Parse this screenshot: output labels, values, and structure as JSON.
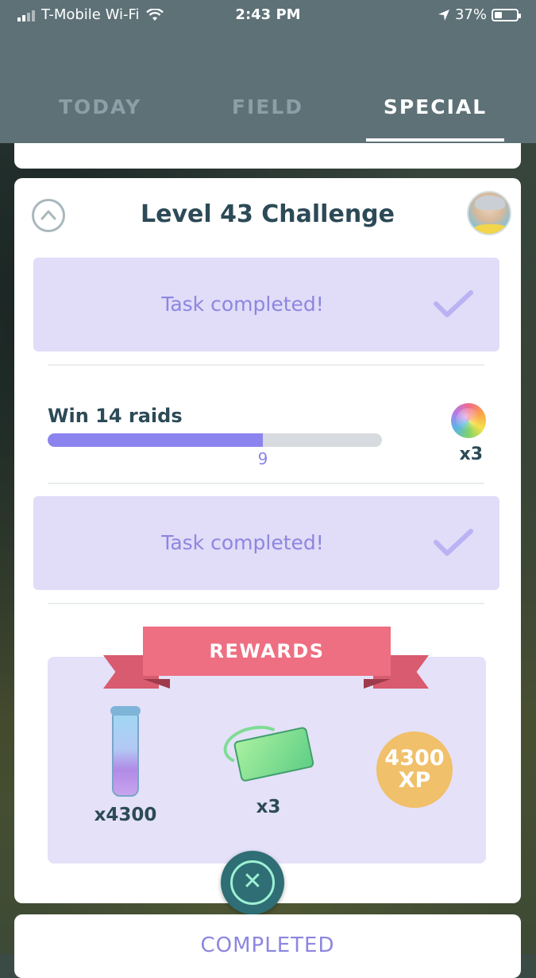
{
  "status_bar": {
    "carrier": "T-Mobile Wi-Fi",
    "time": "2:43 PM",
    "battery": "37%"
  },
  "tabs": [
    {
      "label": "TODAY",
      "active": false
    },
    {
      "label": "FIELD",
      "active": false
    },
    {
      "label": "SPECIAL",
      "active": true
    }
  ],
  "challenge": {
    "title": "Level 43 Challenge",
    "tasks": [
      {
        "status": "Task completed!"
      },
      {
        "label": "Win 14 raids",
        "progress": 9,
        "goal": 14,
        "reward_icon": "rainbow-berry-icon",
        "reward_count": "x3"
      },
      {
        "status": "Task completed!"
      }
    ]
  },
  "rewards": {
    "header": "REWARDS",
    "items": [
      {
        "icon": "stardust-icon",
        "count": "x4300"
      },
      {
        "icon": "raid-pass-icon",
        "count": "x3"
      },
      {
        "icon": "xp-icon",
        "line1": "4300",
        "line2": "XP"
      }
    ]
  },
  "next_card": {
    "label": "COMPLETED"
  },
  "colors": {
    "header_bg": "#5d7177",
    "accent_purple": "#8b84ee",
    "task_done_bg": "#e1dcf8",
    "ribbon": "#ee6f82",
    "xp_coin": "#f0c06a"
  }
}
